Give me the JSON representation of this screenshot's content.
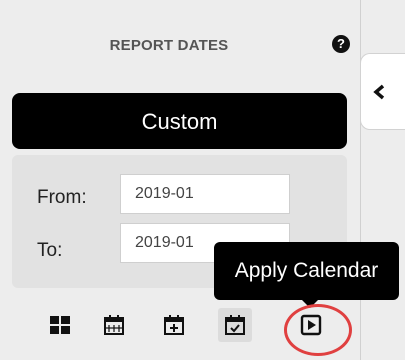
{
  "header": {
    "title": "REPORT DATES",
    "help_icon": "?"
  },
  "range_button": {
    "label": "Custom"
  },
  "dates": {
    "from_label": "From:",
    "from_value": "2019-01",
    "to_label": "To:",
    "to_value": "2019-01"
  },
  "tooltip": {
    "text": "Apply Calendar"
  },
  "toolbar": {
    "icons": [
      "grid-icon",
      "calendar-icon",
      "calendar-add-icon",
      "calendar-check-icon",
      "apply-play-icon"
    ]
  },
  "colors": {
    "highlight_circle": "#e04040",
    "button_bg": "#000000"
  }
}
